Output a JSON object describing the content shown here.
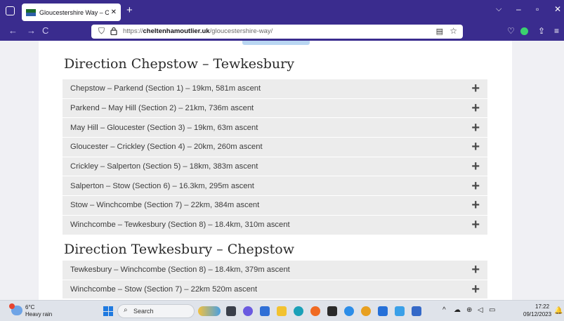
{
  "browser": {
    "tab_title": "Gloucestershire Way – Cheltenham Outlier",
    "tab_close": "✕",
    "new_tab": "+",
    "list_all_tabs": "⌵",
    "window_controls": {
      "minimize": "–",
      "maximize": "▫",
      "close": "✕"
    },
    "nav": {
      "back": "←",
      "forward": "→",
      "reload": "C"
    },
    "url_scheme": "https://",
    "url_domain": "cheltenhamoutlier.uk",
    "url_path": "/gloucestershire-way/",
    "reader_icon": "▤",
    "bookmark_icon": "☆",
    "pocket_icon": "♡",
    "share_icon": "⇪",
    "menu_icon": "≡"
  },
  "content": {
    "sections": [
      {
        "heading": "Direction Chepstow – Tewkesbury",
        "items": [
          "Chepstow – Parkend (Section 1) – 19km, 581m ascent",
          "Parkend – May Hill (Section 2) – 21km, 736m ascent",
          "May Hill – Gloucester (Section 3) – 19km, 63m ascent",
          "Gloucester – Crickley (Section 4) – 20km, 260m ascent",
          "Crickley – Salperton (Section 5) – 18km, 383m ascent",
          "Salperton – Stow (Section 6) – 16.3km, 295m ascent",
          "Stow – Winchcombe (Section 7) – 22km, 384m ascent",
          "Winchcombe – Tewkesbury (Section 8) – 18.4km, 310m ascent"
        ]
      },
      {
        "heading": "Direction Tewkesbury – Chepstow",
        "items": [
          "Tewkesbury – Winchcombe (Section 8) – 18.4km, 379m ascent",
          "Winchcombe – Stow (Section 7) – 22km 520m ascent"
        ]
      }
    ],
    "expand_icon": "+"
  },
  "taskbar": {
    "weather_temp": "6°C",
    "weather_condition": "Heavy rain",
    "search_label": "Search",
    "search_icon": "⌕",
    "time": "17:22",
    "date": "09/12/2023",
    "tray_chevron": "^",
    "bell_icon": "🔔"
  }
}
